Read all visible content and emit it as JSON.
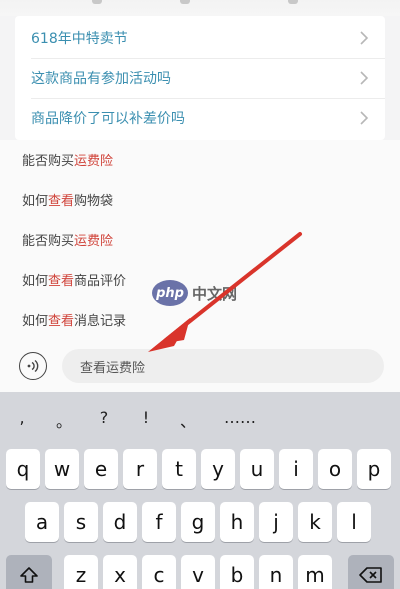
{
  "faq": [
    {
      "text": "618年中特卖节"
    },
    {
      "text": "这款商品有参加活动吗"
    },
    {
      "text": "商品降价了可以补差价吗"
    }
  ],
  "suggestions": [
    {
      "pre": "能否购买",
      "hl": "运费险",
      "post": ""
    },
    {
      "pre": "如何",
      "hl": "查看",
      "post": "购物袋"
    },
    {
      "pre": "能否购买",
      "hl": "运费险",
      "post": ""
    },
    {
      "pre": "如何",
      "hl": "查看",
      "post": "商品评价"
    },
    {
      "pre": "如何",
      "hl": "查看",
      "post": "消息记录"
    }
  ],
  "watermark": {
    "badge": "php",
    "text": "中文网"
  },
  "input": {
    "value": "查看运费险"
  },
  "keyboard": {
    "punct": [
      ",",
      "。",
      "?",
      "!",
      "、",
      "……"
    ],
    "row1": [
      "q",
      "w",
      "e",
      "r",
      "t",
      "y",
      "u",
      "i",
      "o",
      "p"
    ],
    "row2": [
      "a",
      "s",
      "d",
      "f",
      "g",
      "h",
      "j",
      "k",
      "l"
    ],
    "row3": [
      "z",
      "x",
      "c",
      "v",
      "b",
      "n",
      "m"
    ]
  },
  "colors": {
    "accent_blue": "#3b8fb0",
    "highlight_red": "#d0443b",
    "arrow_red": "#d9342b"
  },
  "icons": {
    "chevron": "chevron-right-icon",
    "voice": "voice-icon",
    "shift": "shift-icon",
    "delete": "backspace-icon"
  }
}
